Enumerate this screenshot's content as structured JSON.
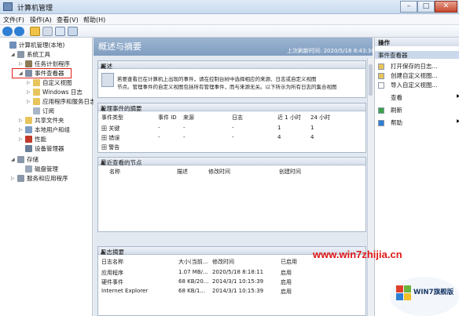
{
  "window": {
    "title": "计算机管理",
    "min": "–",
    "max": "□",
    "close": "✕"
  },
  "menu": [
    "文件(F)",
    "操作(A)",
    "查看(V)",
    "帮助(H)"
  ],
  "tree": [
    {
      "label": "计算机管理(本地)",
      "level": 0,
      "tw": "",
      "icon": "computer-icon",
      "color": "#6f8fb8"
    },
    {
      "label": "系统工具",
      "level": 1,
      "tw": "◢",
      "icon": "tools-icon",
      "color": "#8a97a8"
    },
    {
      "label": "任务计划程序",
      "level": 2,
      "tw": "▷",
      "icon": "clock-icon",
      "color": "#8c7a56"
    },
    {
      "label": "事件查看器",
      "level": 2,
      "tw": "◢",
      "icon": "event-viewer-icon",
      "color": "#7d8da3"
    },
    {
      "label": "自定义视图",
      "level": 3,
      "tw": "▷",
      "icon": "folder-icon",
      "color": "#e8c45d"
    },
    {
      "label": "Windows 日志",
      "level": 3,
      "tw": "▷",
      "icon": "folder-icon",
      "color": "#e8c45d"
    },
    {
      "label": "应用程序和服务日志",
      "level": 3,
      "tw": "▷",
      "icon": "folder-icon",
      "color": "#e8c45d"
    },
    {
      "label": "订阅",
      "level": 3,
      "tw": "",
      "icon": "subscription-icon",
      "color": "#a8b6c8"
    },
    {
      "label": "共享文件夹",
      "level": 2,
      "tw": "▷",
      "icon": "shared-folder-icon",
      "color": "#e8c45d"
    },
    {
      "label": "本地用户和组",
      "level": 2,
      "tw": "▷",
      "icon": "users-icon",
      "color": "#7c9bc2"
    },
    {
      "label": "性能",
      "level": 2,
      "tw": "▷",
      "icon": "performance-icon",
      "color": "#c0392b"
    },
    {
      "label": "设备管理器",
      "level": 2,
      "tw": "",
      "icon": "device-manager-icon",
      "color": "#6b7f99"
    },
    {
      "label": "存储",
      "level": 1,
      "tw": "◢",
      "icon": "storage-icon",
      "color": "#8a97a8"
    },
    {
      "label": "磁盘管理",
      "level": 2,
      "tw": "",
      "icon": "disk-icon",
      "color": "#9aa7b8"
    },
    {
      "label": "服务和应用程序",
      "level": 1,
      "tw": "▷",
      "icon": "services-icon",
      "color": "#8a97a8"
    }
  ],
  "center": {
    "title": "概述与摘要",
    "refresh_text": "上次刷新时间: 2020/5/18 8:43:30",
    "overview": {
      "label": "概述",
      "text_line1": "若要查看已在计算机上出现的事件，请在控制台树中选择相应的来源、日志或自定义视图",
      "text_line2": "节点。管理事件的自定义视图包括所有管理事件，而与来源无关。以下所示为所有日志的集合视图"
    },
    "admin_summary": {
      "label": "管理事件的摘要",
      "headers": [
        "事件类型",
        "事件 ID",
        "来源",
        "日志",
        "近 1 小时",
        "24 小时"
      ],
      "rows": [
        [
          "田 关键",
          "-",
          "-",
          "-",
          "1",
          "1"
        ],
        [
          "田 错误",
          "-",
          "-",
          "-",
          "4",
          "4"
        ],
        [
          "田 警告",
          "",
          "",
          "",
          "",
          ""
        ]
      ]
    },
    "recent_nodes": {
      "label": "最近查看的节点",
      "headers": [
        "名称",
        "描述",
        "修改时间",
        "创建时间"
      ]
    },
    "log_summary": {
      "label": "日志摘要",
      "headers": [
        "日志名称",
        "大小(当前...",
        "修改时间",
        "已启用"
      ],
      "rows": [
        [
          "应用程序",
          "1.07 MB/...",
          "2020/5/18 8:18:11",
          "启用"
        ],
        [
          "硬件事件",
          "68 KB/20...",
          "2014/3/1 10:15:39",
          "启用"
        ],
        [
          "Internet Explorer",
          "68 KB/1...",
          "2014/3/1 10:15:39",
          "启用"
        ]
      ]
    }
  },
  "actions": {
    "header": "操作",
    "group": "事件查看器",
    "items": [
      {
        "label": "打开保存的日志...",
        "icon": "open-log-icon",
        "color": "#e8c45d",
        "chev": ""
      },
      {
        "label": "创建自定义视图...",
        "icon": "create-view-icon",
        "color": "#e8c45d",
        "chev": ""
      },
      {
        "label": "导入自定义视图...",
        "icon": "import-view-icon",
        "color": "#ffffff",
        "chev": ""
      },
      {
        "label": "查看",
        "icon": "",
        "color": "#ffffff",
        "chev": "▶"
      },
      {
        "label": "刷新",
        "icon": "refresh-icon",
        "color": "#3aa24a",
        "chev": ""
      },
      {
        "label": "帮助",
        "icon": "help-icon",
        "color": "#2f7fd4",
        "chev": "▶"
      }
    ]
  },
  "watermark": {
    "site": "www.win7zhijia.cn",
    "logo_text": "WIN7旗舰版",
    "logo_mark": "Win"
  }
}
